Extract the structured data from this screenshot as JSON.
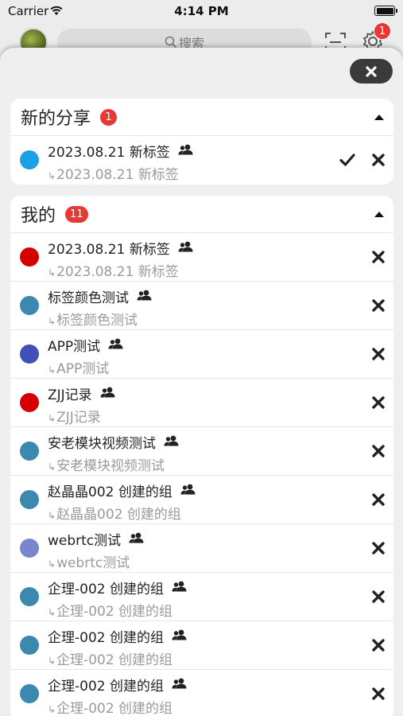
{
  "status_bar": {
    "carrier": "Carrier",
    "time": "4:14 PM"
  },
  "header": {
    "search_placeholder": "搜索",
    "settings_badge": "1"
  },
  "shared_section": {
    "title": "新的分享",
    "badge": "1",
    "items": [
      {
        "name": "2023.08.21 新标签",
        "sub": "2023.08.21 新标签",
        "color": "#1aa0e6"
      }
    ]
  },
  "mine_section": {
    "title": "我的",
    "badge": "11",
    "items": [
      {
        "name": "2023.08.21 新标签",
        "sub": "2023.08.21 新标签",
        "color": "#d50000"
      },
      {
        "name": "标签颜色测试",
        "sub": "标签颜色测试",
        "color": "#3d88b0"
      },
      {
        "name": "APP测试",
        "sub": "APP测试",
        "color": "#3f51b5"
      },
      {
        "name": "ZJJ记录",
        "sub": "ZJJ记录",
        "color": "#d50000"
      },
      {
        "name": "安老模块视频测试",
        "sub": "安老模块视频测试",
        "color": "#3d88b0"
      },
      {
        "name": "赵晶晶002 创建的组",
        "sub": "赵晶晶002 创建的组",
        "color": "#3d88b0"
      },
      {
        "name": "webrtc测试",
        "sub": "webrtc测试",
        "color": "#7986cb"
      },
      {
        "name": "企理-002 创建的组",
        "sub": "企理-002 创建的组",
        "color": "#3d88b0"
      },
      {
        "name": "企理-002 创建的组",
        "sub": "企理-002 创建的组",
        "color": "#3d88b0"
      },
      {
        "name": "企理-002 创建的组",
        "sub": "企理-002 创建的组",
        "color": "#3d88b0"
      }
    ]
  },
  "icons": {
    "status": [
      "wifi-icon",
      "battery-icon"
    ],
    "header": [
      "search-icon",
      "scan-icon",
      "gear-icon"
    ],
    "row": [
      "people-icon",
      "check-icon",
      "close-icon"
    ],
    "section": [
      "caret-up-icon"
    ]
  }
}
